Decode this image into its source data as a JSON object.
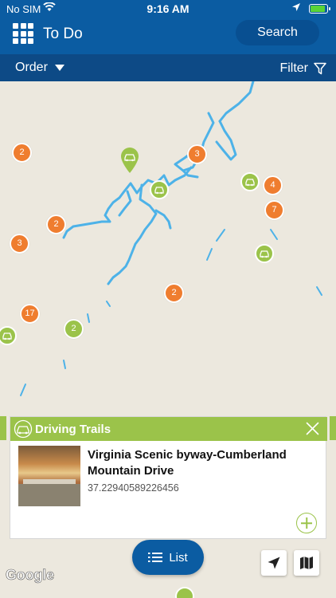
{
  "status_bar": {
    "carrier": "No SIM",
    "time": "9:16 AM"
  },
  "header": {
    "title": "To Do",
    "search_label": "Search"
  },
  "toolbar": {
    "order_label": "Order",
    "filter_label": "Filter"
  },
  "map": {
    "clusters": [
      "2",
      "3",
      "4",
      "7",
      "2",
      "3",
      "2",
      "17",
      "2"
    ],
    "attribution": "Google"
  },
  "card": {
    "category": "Driving Trails",
    "place_name": "Virginia Scenic byway-Cumberland Mountain Drive",
    "coordinate": "37.22940589226456"
  },
  "bottom": {
    "list_label": "List"
  },
  "colors": {
    "primary": "#0b5ca2",
    "dark_primary": "#0d4a86",
    "accent_green": "#9bc34a",
    "cluster_orange": "#ef7d2f",
    "water": "#4db2e8"
  }
}
